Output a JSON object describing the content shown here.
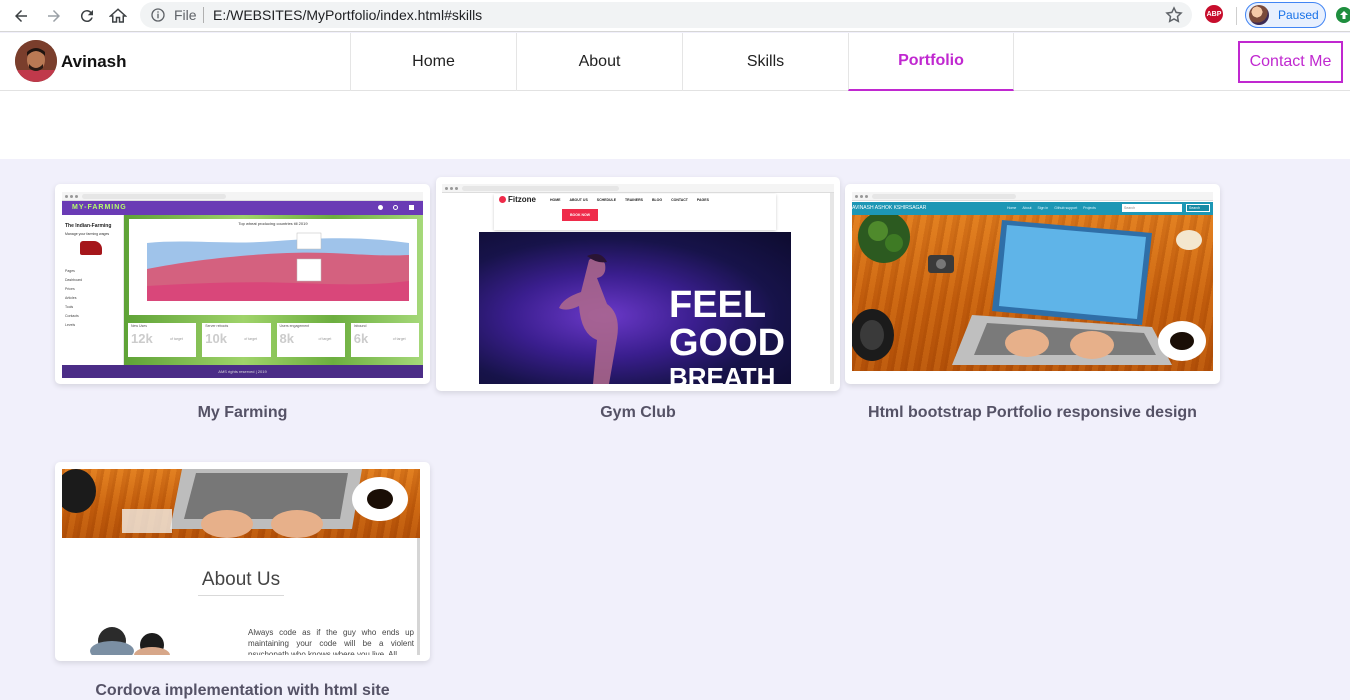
{
  "browser": {
    "file_label": "File",
    "url": "E:/WEBSITES/MyPortfolio/index.html#skills",
    "abp_label": "ABP",
    "profile_status": "Paused"
  },
  "header": {
    "brand": "Avinash",
    "menu": [
      {
        "label": "Home",
        "active": false
      },
      {
        "label": "About",
        "active": false
      },
      {
        "label": "Skills",
        "active": false
      },
      {
        "label": "Portfolio",
        "active": true
      }
    ],
    "contact_label": "Contact Me",
    "accent_color": "#c028d0"
  },
  "portfolio": {
    "items": [
      {
        "title": "My Farming",
        "shot": {
          "app_name": "MY-FARMING",
          "sidebar_title": "The Indian-Farming",
          "sidebar_sub": "Manage your farming wages",
          "sidebar_links": [
            "Pages",
            "Dashboard",
            "Prices",
            "Articles",
            "Tools",
            "Contacts",
            "Levels"
          ],
          "chart_title": "Top wheat producing countries till 2019",
          "stats": [
            {
              "label": "New Uses",
              "value": "12k",
              "note": "of target"
            },
            {
              "label": "Server reboots",
              "value": "10k",
              "note": "of target"
            },
            {
              "label": "Users engagement",
              "value": "8k",
              "note": "of target"
            },
            {
              "label": "Inbound",
              "value": "6k",
              "note": "of target"
            }
          ],
          "footer": "AMS rights reserved | 2019"
        }
      },
      {
        "title": "Gym Club",
        "shot": {
          "logo": "Fitzone",
          "nav": [
            "HOME",
            "ABOUT US",
            "SCHEDULE",
            "TRAINERS",
            "BLOG",
            "CONTACT",
            "PAGES"
          ],
          "cta": "BOOK NOW",
          "hero_lines": [
            "FEEL",
            "GOOD",
            "BREATH"
          ]
        }
      },
      {
        "title": "Html bootstrap Portfolio responsive design",
        "shot": {
          "site_name": "AVINASH ASHOK KSHIRSAGAR",
          "nav": [
            "Home",
            "About",
            "Sign in",
            "Github support",
            "Projects"
          ],
          "search_placeholder": "Search",
          "search_button": "Search"
        }
      },
      {
        "title": "Cordova implementation with html site",
        "shot": {
          "heading": "About Us",
          "quote": "Always code as if the guy who ends up maintaining your code will be a violent psychopath who knows where you live. All"
        }
      }
    ]
  }
}
